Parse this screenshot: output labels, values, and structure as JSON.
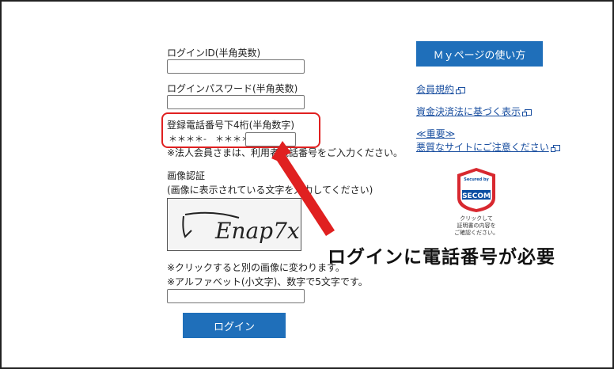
{
  "form": {
    "login_id_label": "ログインID(半角英数)",
    "password_label": "ログインパスワード(半角英数)",
    "phone_label": "登録電話番号下4桁(半角数字)",
    "phone_mask": "＊＊＊＊-　＊＊＊＊-",
    "corporate_note": "※法人会員さまは、利用者電話番号をご入力ください。",
    "captcha_title": "画像認証",
    "captcha_instruction": "(画像に表示されている文字を入力してください)",
    "captcha_text": "Enap7x",
    "captcha_note1": "※クリックすると別の画像に変わります。",
    "captcha_note2": "※アルファベット(小文字)、数字で5文字です。",
    "login_button": "ログイン"
  },
  "sidebar": {
    "mypage_button": "Ｍｙページの使い方",
    "links": [
      {
        "label": "会員規約"
      },
      {
        "label": "資金決済法に基づく表示"
      }
    ],
    "important_label": "≪重要≫",
    "warning_link": "悪質なサイトにご注意ください"
  },
  "seal": {
    "top": "Secured by",
    "brand": "SECOM",
    "caption_line1": "クリックして",
    "caption_line2": "証明書の内容を",
    "caption_line3": "ご確認ください。"
  },
  "annotation": {
    "text": "ログインに電話番号が必要"
  },
  "colors": {
    "accent": "#1f6fba",
    "link": "#1a4fa0",
    "annotation_red": "#e02020",
    "secom_red": "#d8282f",
    "secom_blue": "#0b4ea2"
  }
}
